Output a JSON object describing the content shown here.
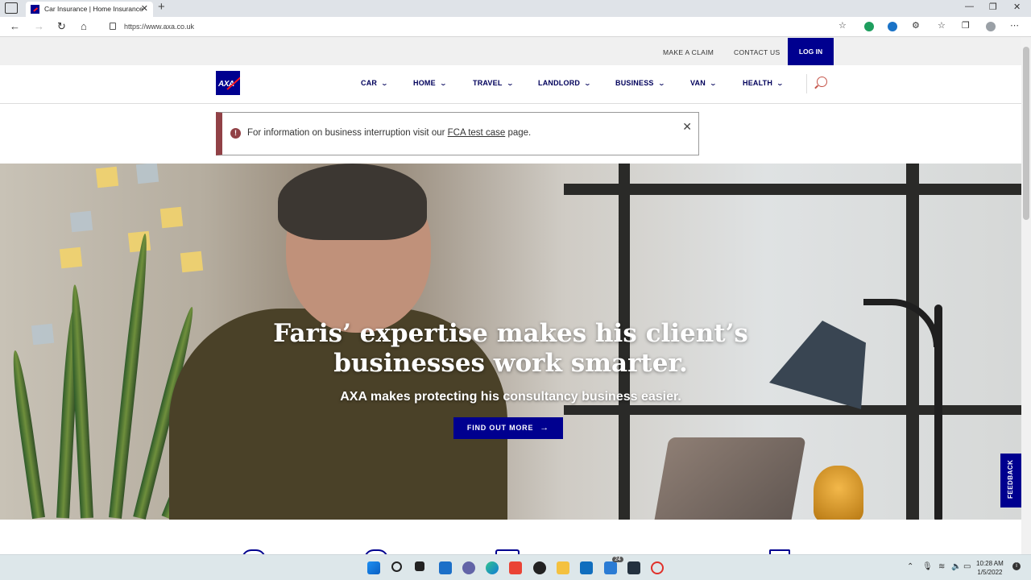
{
  "browser": {
    "tab_title": "Car Insurance | Home Insurance",
    "tab_close": "✕",
    "new_tab": "+",
    "url": "https://www.axa.co.uk",
    "window_controls": [
      "—",
      "❐",
      "✕"
    ]
  },
  "utility_nav": {
    "make_a_claim": "MAKE A CLAIM",
    "contact_us": "CONTACT US",
    "log_in": "LOG IN"
  },
  "logo": {
    "text": "AXA"
  },
  "main_nav": {
    "items": [
      {
        "label": "CAR"
      },
      {
        "label": "HOME"
      },
      {
        "label": "TRAVEL"
      },
      {
        "label": "LANDLORD"
      },
      {
        "label": "BUSINESS"
      },
      {
        "label": "VAN"
      },
      {
        "label": "HEALTH"
      }
    ],
    "chevron": "⌄"
  },
  "alert": {
    "icon": "!",
    "text_before": "For information on business interruption visit our ",
    "link_text": "FCA test case",
    "text_after": " page.",
    "close": "✕"
  },
  "hero": {
    "headline_line1": "Faris’ expertise makes his client’s",
    "headline_line2": "businesses work smarter.",
    "subheading": "AXA makes protecting his consultancy business easier.",
    "cta_label": "FIND OUT MORE",
    "cta_arrow": "→"
  },
  "feedback_tab": "FEEDBACK",
  "taskbar": {
    "time": "10:28 AM",
    "date": "1/5/2022",
    "mail_badge": "24"
  },
  "colors": {
    "axa_blue": "#00008f",
    "axa_red": "#ff1721",
    "alert_accent": "#914146"
  },
  "icons": [
    "favicon-axa",
    "lock-icon",
    "search-icon",
    "info-icon",
    "close-icon",
    "arrow-right-icon",
    "chevron-down-icon"
  ]
}
